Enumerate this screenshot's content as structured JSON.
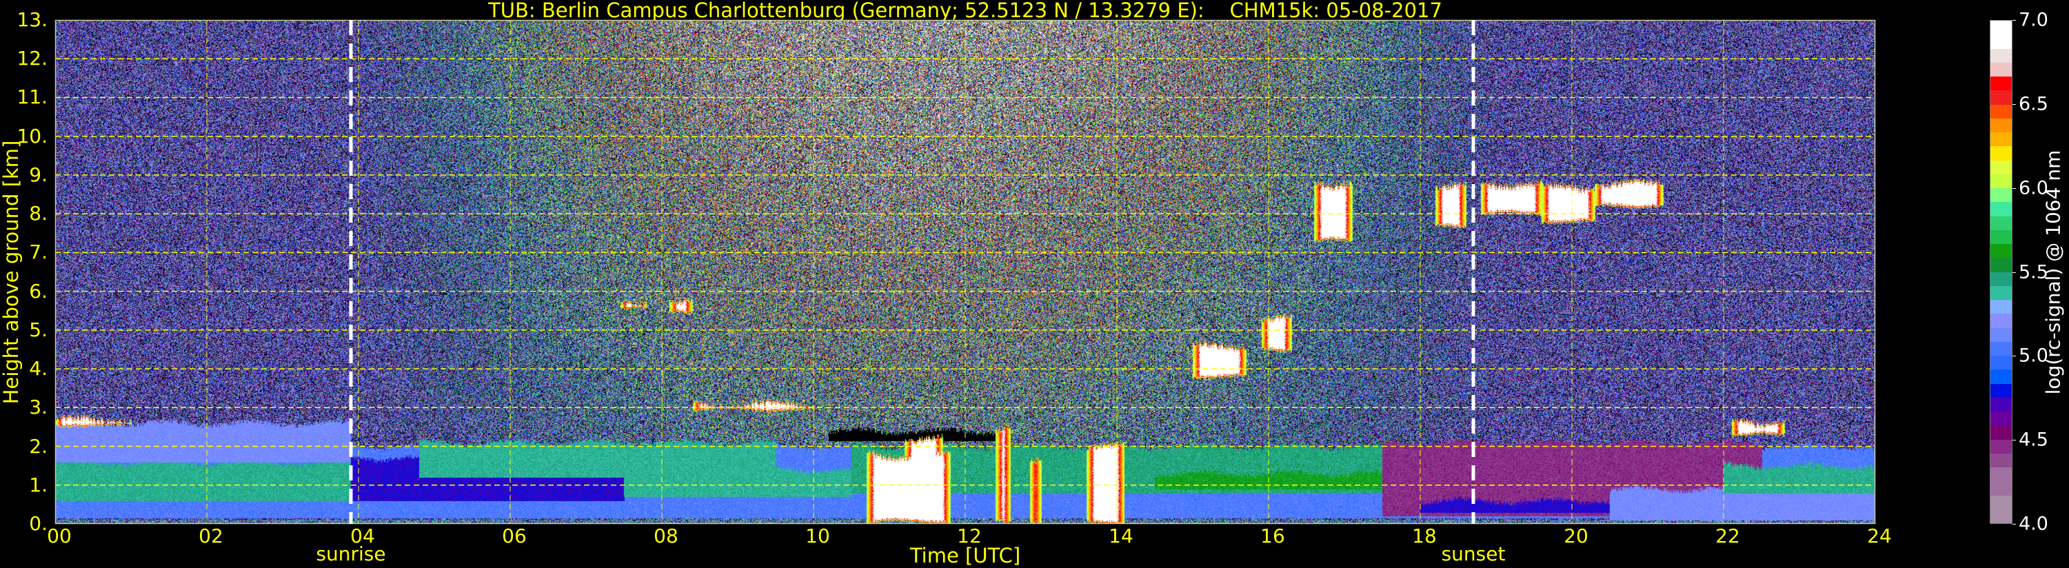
{
  "title": "TUB: Berlin Campus Charlottenburg (Germany; 52.5123 N / 13.3279 E):    CHM15k: 05-08-2017",
  "chart_data": {
    "type": "heatmap",
    "title": "TUB: Berlin Campus Charlottenburg (Germany; 52.5123 N / 13.3279 E):    CHM15k: 05-08-2017",
    "xlabel": "Time [UTC]",
    "ylabel": "Height above ground [km]",
    "xlim": [
      0,
      24
    ],
    "ylim": [
      0,
      13
    ],
    "x_ticks": [
      0,
      2,
      4,
      6,
      8,
      10,
      12,
      14,
      16,
      18,
      20,
      22,
      24
    ],
    "x_tick_labels": [
      "00",
      "02",
      "04",
      "06",
      "08",
      "10",
      "12",
      "14",
      "16",
      "18",
      "20",
      "22",
      "24"
    ],
    "y_ticks": [
      0,
      1,
      2,
      3,
      4,
      5,
      6,
      7,
      8,
      9,
      10,
      11,
      12,
      13
    ],
    "y_tick_labels": [
      "0.",
      "1.",
      "2.",
      "3.",
      "4.",
      "5.",
      "6.",
      "7.",
      "8.",
      "9.",
      "10.",
      "11.",
      "12.",
      "13."
    ],
    "grid": true,
    "events": [
      {
        "label": "sunrise",
        "time": 3.9
      },
      {
        "label": "sunset",
        "time": 18.7
      }
    ],
    "colorbar": {
      "label": "log(rc-signal) @ 1064 nm",
      "clim": [
        4.0,
        7.0
      ],
      "ticks": [
        4.0,
        4.5,
        5.0,
        5.5,
        6.0,
        6.5,
        7.0
      ],
      "tick_labels": [
        "4.0",
        "4.5",
        "5.0",
        "5.5",
        "6.0",
        "6.5",
        "7.0"
      ],
      "colors": [
        "#a98ea8",
        "#a98ea8",
        "#a070a0",
        "#a070a0",
        "#904a90",
        "#8a2a88",
        "#7a0070",
        "#6a00a0",
        "#4a00b8",
        "#0010e0",
        "#0060ff",
        "#2e6cff",
        "#4878ff",
        "#6e88ff",
        "#8890ff",
        "#80b0ff",
        "#30c0a0",
        "#20a080",
        "#109030",
        "#10a010",
        "#20c050",
        "#30d070",
        "#40e8a0",
        "#80ff80",
        "#c8ff40",
        "#e0ff40",
        "#ffe800",
        "#ffb000",
        "#ff9000",
        "#ff5000",
        "#f02020",
        "#ff0000",
        "#f0c4c4",
        "#ece0e0",
        "#ffffff",
        "#ffffff"
      ]
    },
    "boundary_layers": [
      {
        "t": [
          0,
          24
        ],
        "h": [
          0.15,
          2.0
        ],
        "value": 5.05
      },
      {
        "t": [
          0,
          3.9
        ],
        "h": [
          0.6,
          1.6
        ],
        "value": 5.42
      },
      {
        "t": [
          0,
          3.9
        ],
        "h": [
          1.6,
          2.6
        ],
        "value": 5.15
      },
      {
        "t": [
          3.9,
          7.5
        ],
        "h": [
          0.6,
          1.7
        ],
        "value": 4.75
      },
      {
        "t": [
          4.8,
          9.5
        ],
        "h": [
          1.2,
          2.1
        ],
        "value": 5.4
      },
      {
        "t": [
          7.5,
          10.5
        ],
        "h": [
          0.7,
          1.4
        ],
        "value": 5.4
      },
      {
        "t": [
          10.5,
          18.0
        ],
        "h": [
          0.8,
          2.0
        ],
        "value": 5.45
      },
      {
        "t": [
          14.5,
          18.0
        ],
        "h": [
          0.9,
          1.3
        ],
        "value": 5.62
      },
      {
        "t": [
          17.5,
          22.5
        ],
        "h": [
          0.2,
          2.1
        ],
        "value": 4.45
      },
      {
        "t": [
          18.0,
          21.0
        ],
        "h": [
          0.3,
          0.6
        ],
        "value": 4.75
      },
      {
        "t": [
          20.5,
          24.0
        ],
        "h": [
          0.1,
          0.9
        ],
        "value": 5.15
      },
      {
        "t": [
          22.0,
          24.0
        ],
        "h": [
          0.8,
          1.5
        ],
        "value": 5.42
      },
      {
        "t": [
          10.2,
          12.5
        ],
        "h": [
          2.15,
          2.4
        ],
        "value": 3.0
      }
    ],
    "clouds": [
      {
        "t": [
          0.0,
          1.0
        ],
        "h": [
          2.55,
          2.7
        ]
      },
      {
        "t": [
          7.45,
          7.8
        ],
        "h": [
          5.55,
          5.75
        ]
      },
      {
        "t": [
          8.1,
          8.4
        ],
        "h": [
          5.5,
          5.7
        ]
      },
      {
        "t": [
          8.4,
          10.0
        ],
        "h": [
          2.95,
          3.1
        ]
      },
      {
        "t": [
          10.7,
          11.8
        ],
        "h": [
          0.05,
          1.8
        ]
      },
      {
        "t": [
          11.2,
          11.7
        ],
        "h": [
          0.05,
          2.2
        ]
      },
      {
        "t": [
          12.4,
          12.6
        ],
        "h": [
          0.05,
          2.5
        ]
      },
      {
        "t": [
          12.85,
          13.0
        ],
        "h": [
          0.05,
          1.6
        ]
      },
      {
        "t": [
          13.6,
          14.1
        ],
        "h": [
          0.05,
          2.0
        ]
      },
      {
        "t": [
          15.0,
          15.7
        ],
        "h": [
          3.8,
          4.6
        ]
      },
      {
        "t": [
          15.9,
          16.3
        ],
        "h": [
          4.5,
          5.3
        ]
      },
      {
        "t": [
          16.6,
          17.1
        ],
        "h": [
          7.3,
          8.8
        ]
      },
      {
        "t": [
          18.2,
          18.6
        ],
        "h": [
          7.7,
          8.7
        ]
      },
      {
        "t": [
          18.8,
          19.6
        ],
        "h": [
          8.0,
          8.8
        ]
      },
      {
        "t": [
          19.6,
          20.3
        ],
        "h": [
          7.8,
          8.7
        ]
      },
      {
        "t": [
          20.3,
          21.2
        ],
        "h": [
          8.2,
          8.8
        ]
      },
      {
        "t": [
          22.1,
          22.8
        ],
        "h": [
          2.3,
          2.65
        ]
      }
    ]
  }
}
